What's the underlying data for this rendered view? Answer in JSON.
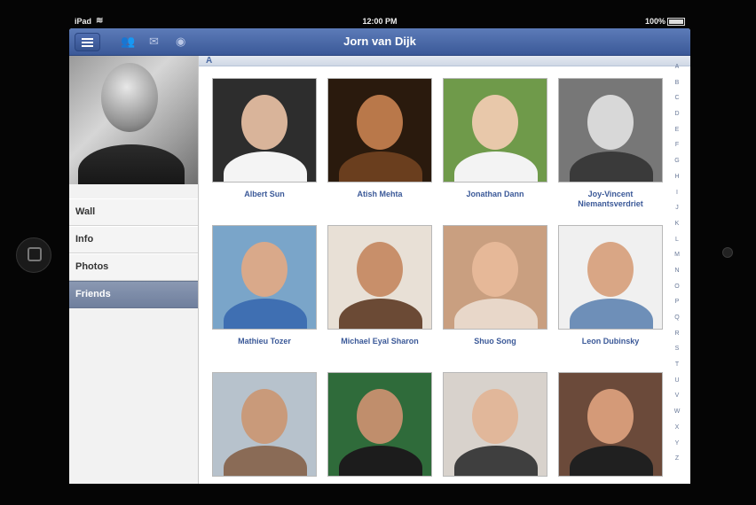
{
  "status_bar": {
    "carrier": "iPad",
    "time": "12:00 PM",
    "battery": "100%"
  },
  "nav": {
    "title": "Jorn van Dijk",
    "icons": [
      "menu-icon",
      "friend-requests-icon",
      "messages-icon",
      "notifications-globe-icon"
    ]
  },
  "sidebar": {
    "items": [
      {
        "label": "Wall",
        "active": false
      },
      {
        "label": "Info",
        "active": false
      },
      {
        "label": "Photos",
        "active": false
      },
      {
        "label": "Friends",
        "active": true
      }
    ]
  },
  "friends": {
    "section": "A",
    "list": [
      {
        "name": "Albert Sun",
        "bg": "#2d2d2d",
        "face": "#d9b49a",
        "body": "#f4f4f4"
      },
      {
        "name": "Atish Mehta",
        "bg": "#2a1a0d",
        "face": "#b9784a",
        "body": "#6a3e1e"
      },
      {
        "name": "Jonathan Dann",
        "bg": "#6f9a4a",
        "face": "#e8c8aa",
        "body": "#f3f3f3"
      },
      {
        "name": "Joy-Vincent Niemantsverdriet",
        "bg": "#777777",
        "face": "#d8d8d8",
        "body": "#3a3a3a"
      },
      {
        "name": "Mathieu Tozer",
        "bg": "#7aa5c9",
        "face": "#d9a98a",
        "body": "#3f6fb2"
      },
      {
        "name": "Michael Eyal Sharon",
        "bg": "#e8e0d6",
        "face": "#c88f6a",
        "body": "#6b4a35"
      },
      {
        "name": "Shuo Song",
        "bg": "#c99f80",
        "face": "#e6b898",
        "body": "#e8d7c9"
      },
      {
        "name": "Leon Dubinsky",
        "bg": "#f0f0f0",
        "face": "#d9a685",
        "body": "#6e8fb8"
      },
      {
        "name": "",
        "bg": "#b7c2cc",
        "face": "#c99a7a",
        "body": "#8a6b56"
      },
      {
        "name": "",
        "bg": "#2f6b3a",
        "face": "#c08e6c",
        "body": "#1c1c1c"
      },
      {
        "name": "",
        "bg": "#d8d2cc",
        "face": "#e1b79a",
        "body": "#3f3f3f"
      },
      {
        "name": "",
        "bg": "#6b4a3a",
        "face": "#d49a78",
        "body": "#202020"
      }
    ]
  },
  "index_letters": [
    "A",
    "B",
    "C",
    "D",
    "E",
    "F",
    "G",
    "H",
    "I",
    "J",
    "K",
    "L",
    "M",
    "N",
    "O",
    "P",
    "Q",
    "R",
    "S",
    "T",
    "U",
    "V",
    "W",
    "X",
    "Y",
    "Z"
  ]
}
